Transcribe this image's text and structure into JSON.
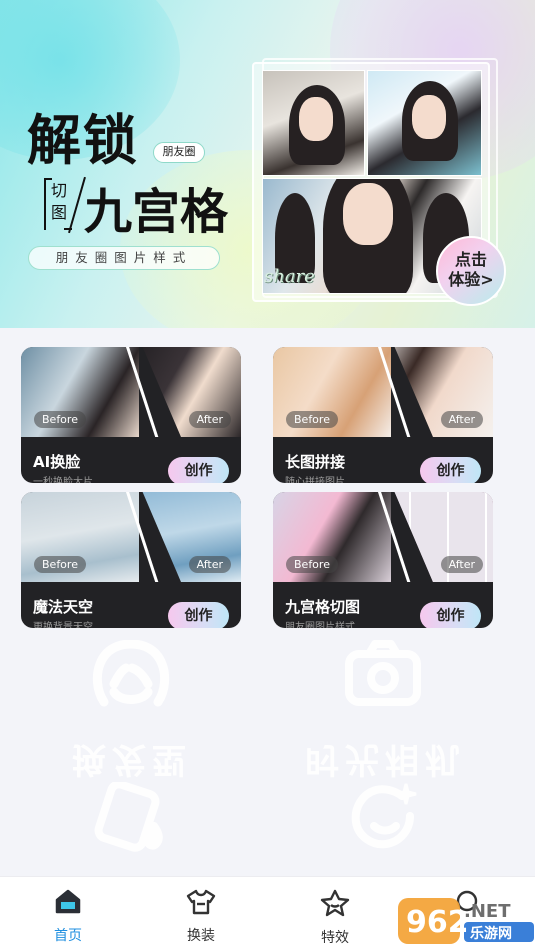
{
  "banner": {
    "title_line1": "解锁",
    "tag": "朋友圈",
    "small_text": "切图",
    "title_line2": "九宫格",
    "subtitle": "朋友圈图片样式",
    "photo_caption": "share",
    "cta": "点击体验>"
  },
  "cards": [
    {
      "title": "AI换脸",
      "subtitle": "一秒换脸大片",
      "before": "Before",
      "after": "After",
      "button": "创作"
    },
    {
      "title": "长图拼接",
      "subtitle": "随心拼接图片",
      "before": "Before",
      "after": "After",
      "button": "创作"
    },
    {
      "title": "魔法天空",
      "subtitle": "更换背景天空",
      "before": "Before",
      "after": "After",
      "button": "创作"
    },
    {
      "title": "九宫格切图",
      "subtitle": "朋友圈图片样式",
      "before": "Before",
      "after": "After",
      "button": "创作"
    }
  ],
  "categories": [
    {
      "label": "换发型",
      "icon": "hair-icon"
    },
    {
      "label": "时光相机",
      "icon": "camera-icon"
    },
    {
      "label": "",
      "icon": "sticker-icon"
    },
    {
      "label": "",
      "icon": "sparkle-face-icon"
    }
  ],
  "nav": {
    "items": [
      {
        "label": "首页",
        "icon": "home-icon",
        "active": true
      },
      {
        "label": "换装",
        "icon": "tshirt-icon",
        "active": false
      },
      {
        "label": "特效",
        "icon": "star-icon",
        "active": false
      },
      {
        "label": "",
        "icon": "profile-icon",
        "active": false
      }
    ]
  },
  "watermark": {
    "text": "962.NET",
    "subtext": "乐游网"
  },
  "colors": {
    "accent": "#1f8fe0",
    "card_bg": "#222225",
    "page_bg": "#f3f4f9"
  }
}
